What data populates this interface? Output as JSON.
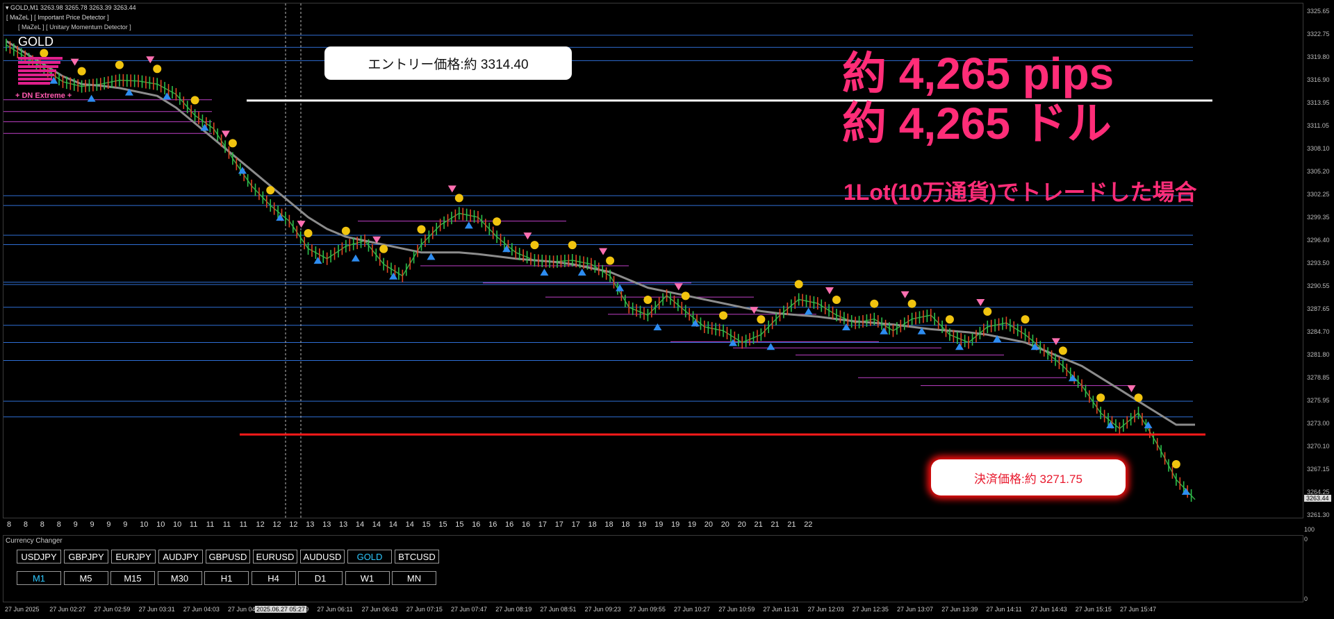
{
  "header": {
    "symbol_line": "GOLD,M1  3263.98 3265.78 3263.39 3263.44",
    "indicator1": "[ MaZeL ] [ Important Price Detector ]",
    "indicator2": "[ MaZeL ] [ Unitary Momentum Detector ]"
  },
  "panel": {
    "symbol": "GOLD",
    "signal": "+ DN Extreme +"
  },
  "annotations": {
    "entry": "エントリー価格:約  3314.40",
    "exit": "決済価格:約 3271.75",
    "pips": "約 4,265 pips",
    "dollars": "約 4,265 ドル",
    "lot": "1Lot(10万通貨)でトレードした場合"
  },
  "price_axis": [
    "3325.65",
    "3322.75",
    "3319.80",
    "3316.90",
    "3313.95",
    "3311.05",
    "3308.10",
    "3305.20",
    "3302.25",
    "3299.35",
    "3296.40",
    "3293.50",
    "3290.55",
    "3287.65",
    "3284.70",
    "3281.80",
    "3278.85",
    "3275.95",
    "3273.00",
    "3270.10",
    "3267.15",
    "3264.25",
    "3261.30"
  ],
  "current_price": "3263.44",
  "subpanel_axis": {
    "top": "100",
    "mid": "0",
    "bottom": "0"
  },
  "hour_row": [
    "8",
    "8",
    "8",
    "8",
    "9",
    "9",
    "9",
    "9",
    "10",
    "10",
    "10",
    "11",
    "11",
    "11",
    "11",
    "12",
    "12",
    "12",
    "13",
    "13",
    "13",
    "14",
    "14",
    "14",
    "14",
    "15",
    "15",
    "15",
    "16",
    "16",
    "16",
    "16",
    "17",
    "17",
    "17",
    "18",
    "18",
    "18",
    "19",
    "19",
    "19",
    "19",
    "20",
    "20",
    "20",
    "21",
    "21",
    "21",
    "22"
  ],
  "currency_changer": {
    "title": "Currency Changer",
    "symbols": [
      "USDJPY",
      "GBPJPY",
      "EURJPY",
      "AUDJPY",
      "GBPUSD",
      "EURUSD",
      "AUDUSD",
      "GOLD",
      "BTCUSD"
    ],
    "active_symbol": "GOLD",
    "timeframes": [
      "M1",
      "M5",
      "M15",
      "M30",
      "H1",
      "H4",
      "D1",
      "W1",
      "MN"
    ],
    "active_timeframe": "M1"
  },
  "timeline": {
    "labels": [
      "27 Jun 2025",
      "27 Jun 02:27",
      "27 Jun 02:59",
      "27 Jun 03:31",
      "27 Jun 04:03",
      "27 Jun 04:",
      "27 Jun 05:39",
      "27 Jun 06:11",
      "27 Jun 06:43",
      "27 Jun 07:15",
      "27 Jun 07:47",
      "27 Jun 08:19",
      "27 Jun 08:51",
      "27 Jun 09:23",
      "27 Jun 09:55",
      "27 Jun 10:27",
      "27 Jun 10:59",
      "27 Jun 11:31",
      "27 Jun 12:03",
      "27 Jun 12:35",
      "27 Jun 13:07",
      "27 Jun 13:39",
      "27 Jun 14:11",
      "27 Jun 14:43",
      "27 Jun 15:15",
      "27 Jun 15:47"
    ],
    "highlight": "2025.06.27 05:27"
  },
  "chart_data": {
    "type": "line",
    "title": "",
    "xlabel": "",
    "ylabel": "",
    "ylim": [
      3261.3,
      3325.65
    ],
    "series": [
      {
        "values": [
          3321.5,
          3320.0,
          3318.5,
          3316.8,
          3316.2,
          3316.5,
          3317.0,
          3316.9,
          3316.5,
          3315.2,
          3312.5,
          3310.8,
          3307.0,
          3303.5,
          3301.0,
          3299.0,
          3295.5,
          3294.2,
          3295.8,
          3296.5,
          3293.5,
          3292.0,
          3296.0,
          3298.5,
          3300.0,
          3299.5,
          3297.0,
          3295.0,
          3294.0,
          3293.8,
          3294.0,
          3293.5,
          3292.0,
          3288.0,
          3287.0,
          3289.5,
          3287.5,
          3285.5,
          3285.0,
          3283.5,
          3284.5,
          3287.0,
          3289.0,
          3288.5,
          3287.0,
          3286.0,
          3286.5,
          3285.0,
          3286.5,
          3287.0,
          3284.5,
          3283.5,
          3285.5,
          3286.0,
          3284.5,
          3282.5,
          3280.5,
          3278.0,
          3274.5,
          3272.5,
          3274.5,
          3270.5,
          3266.0,
          3263.44
        ]
      },
      {
        "values": [
          3322.0,
          3320.5,
          3319.0,
          3317.5,
          3316.5,
          3316.3,
          3316.0,
          3315.5,
          3315.0,
          3313.5,
          3311.5,
          3309.5,
          3307.5,
          3305.5,
          3303.5,
          3301.5,
          3299.5,
          3298.0,
          3297.0,
          3296.5,
          3296.0,
          3295.5,
          3295.0,
          3295.0,
          3295.0,
          3294.8,
          3294.5,
          3294.2,
          3294.0,
          3293.8,
          3293.5,
          3293.0,
          3292.5,
          3291.5,
          3290.5,
          3290.0,
          3289.5,
          3289.0,
          3288.5,
          3288.0,
          3287.5,
          3287.2,
          3287.0,
          3286.8,
          3286.5,
          3286.2,
          3286.0,
          3285.8,
          3285.5,
          3285.2,
          3285.0,
          3284.8,
          3284.5,
          3284.0,
          3283.5,
          3282.5,
          3281.5,
          3280.5,
          3279.0,
          3277.5,
          3276.0,
          3274.5,
          3273.0,
          3273.0
        ]
      }
    ],
    "horizontal_levels": {
      "blue": [
        3322.75,
        3321.2,
        3319.5,
        3302.25,
        3301.0,
        3297.2,
        3296.0,
        3291.2,
        3290.9,
        3288.0,
        3285.7,
        3283.5,
        3281.2,
        3276.0,
        3274.0
      ],
      "magenta": [
        3314.5,
        3313.0,
        3311.7,
        3310.2,
        3299.0,
        3293.3,
        3291.1,
        3289.3,
        3287.1,
        3283.6,
        3282.8,
        3281.9,
        3279.0,
        3278.0
      ],
      "entry": 3314.4,
      "exit": 3271.75
    },
    "grid": false
  }
}
